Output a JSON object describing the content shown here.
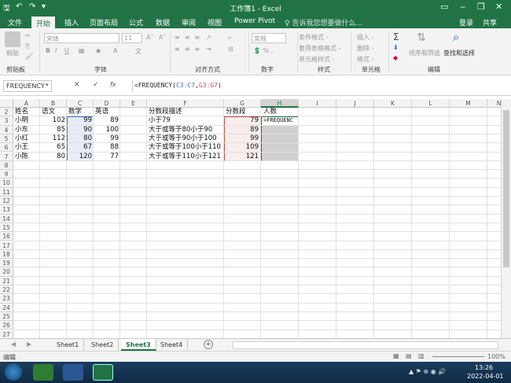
{
  "window": {
    "title": "工作簿1 - Excel",
    "minimize": "‒",
    "restore": "❐",
    "close": "✕"
  },
  "ribbon_tabs": {
    "file": "文件",
    "home": "开始",
    "insert": "插入",
    "page_layout": "页面布局",
    "formulas": "公式",
    "data": "数据",
    "review": "审阅",
    "view": "视图",
    "power_pivot": "Power Pivot",
    "tell_me": "♀ 告诉我您想要做什么...",
    "login": "登录",
    "share": "共享"
  },
  "ribbon": {
    "paste": "粘贴",
    "font_name": "宋体",
    "font_size": "11",
    "groups": {
      "clipboard": "剪贴板",
      "font": "字体",
      "alignment": "对齐方式",
      "number": "数字",
      "styles": "样式",
      "cells": "单元格",
      "editing": "编辑"
    },
    "number_format": "常规",
    "conditional_format": "条件格式 -",
    "table_format": "套用表格格式 -",
    "cell_style": "单元格样式 -",
    "insert": "插入 -",
    "delete": "删除 -",
    "format": "格式 -",
    "sort_filter": "排序和筛选",
    "find_select": "查找和选择"
  },
  "formula_bar": {
    "name_box": "FREQUENCY",
    "cancel": "✕",
    "enter": "✓",
    "fx": "fx",
    "formula_prefix": "=FREQUENCY(",
    "ref1": "C3:C7",
    "comma": ",",
    "ref2": "G3:G7",
    "formula_suffix": ")"
  },
  "columns": [
    "A",
    "B",
    "C",
    "D",
    "E",
    "F",
    "G",
    "H",
    "I",
    "J",
    "K",
    "L",
    "M",
    "N"
  ],
  "rows": [
    "2",
    "3",
    "4",
    "5",
    "6",
    "7",
    "8",
    "9",
    "10",
    "11",
    "12",
    "13",
    "14",
    "15",
    "16",
    "17",
    "18",
    "19",
    "20",
    "21",
    "22",
    "23",
    "24",
    "25",
    "26",
    "27"
  ],
  "headers": {
    "a": "姓名",
    "b": "语文",
    "c": "数学",
    "d": "英语",
    "f": "分数段描述",
    "g": "分数段",
    "h": "人数"
  },
  "table": [
    {
      "name": "小明",
      "chinese": "102",
      "math": "99",
      "english": "89",
      "desc": "小于79",
      "bin": "79"
    },
    {
      "name": "小东",
      "chinese": "85",
      "math": "90",
      "english": "100",
      "desc": "大于或等于80小于90",
      "bin": "89"
    },
    {
      "name": "小红",
      "chinese": "112",
      "math": "80",
      "english": "99",
      "desc": "大于或等于90小于100",
      "bin": "99"
    },
    {
      "name": "小王",
      "chinese": "65",
      "math": "67",
      "english": "88",
      "desc": "大于或等于100小于110",
      "bin": "109"
    },
    {
      "name": "小陈",
      "chinese": "80",
      "math": "120",
      "english": "77",
      "desc": "大于或等于110小于121",
      "bin": "121"
    }
  ],
  "active_cell_text": "=FREQUENC",
  "sheets": [
    "Sheet1",
    "Sheet2",
    "Sheet3",
    "Sheet4"
  ],
  "add_sheet": "+",
  "status": {
    "mode": "编辑",
    "zoom": "100%"
  },
  "taskbar": {
    "time": "13:26",
    "date": "2022-04-01"
  },
  "colors": {
    "accent": "#217346",
    "ref1_border": "#4472c4",
    "ref2_border": "#c0504d"
  }
}
